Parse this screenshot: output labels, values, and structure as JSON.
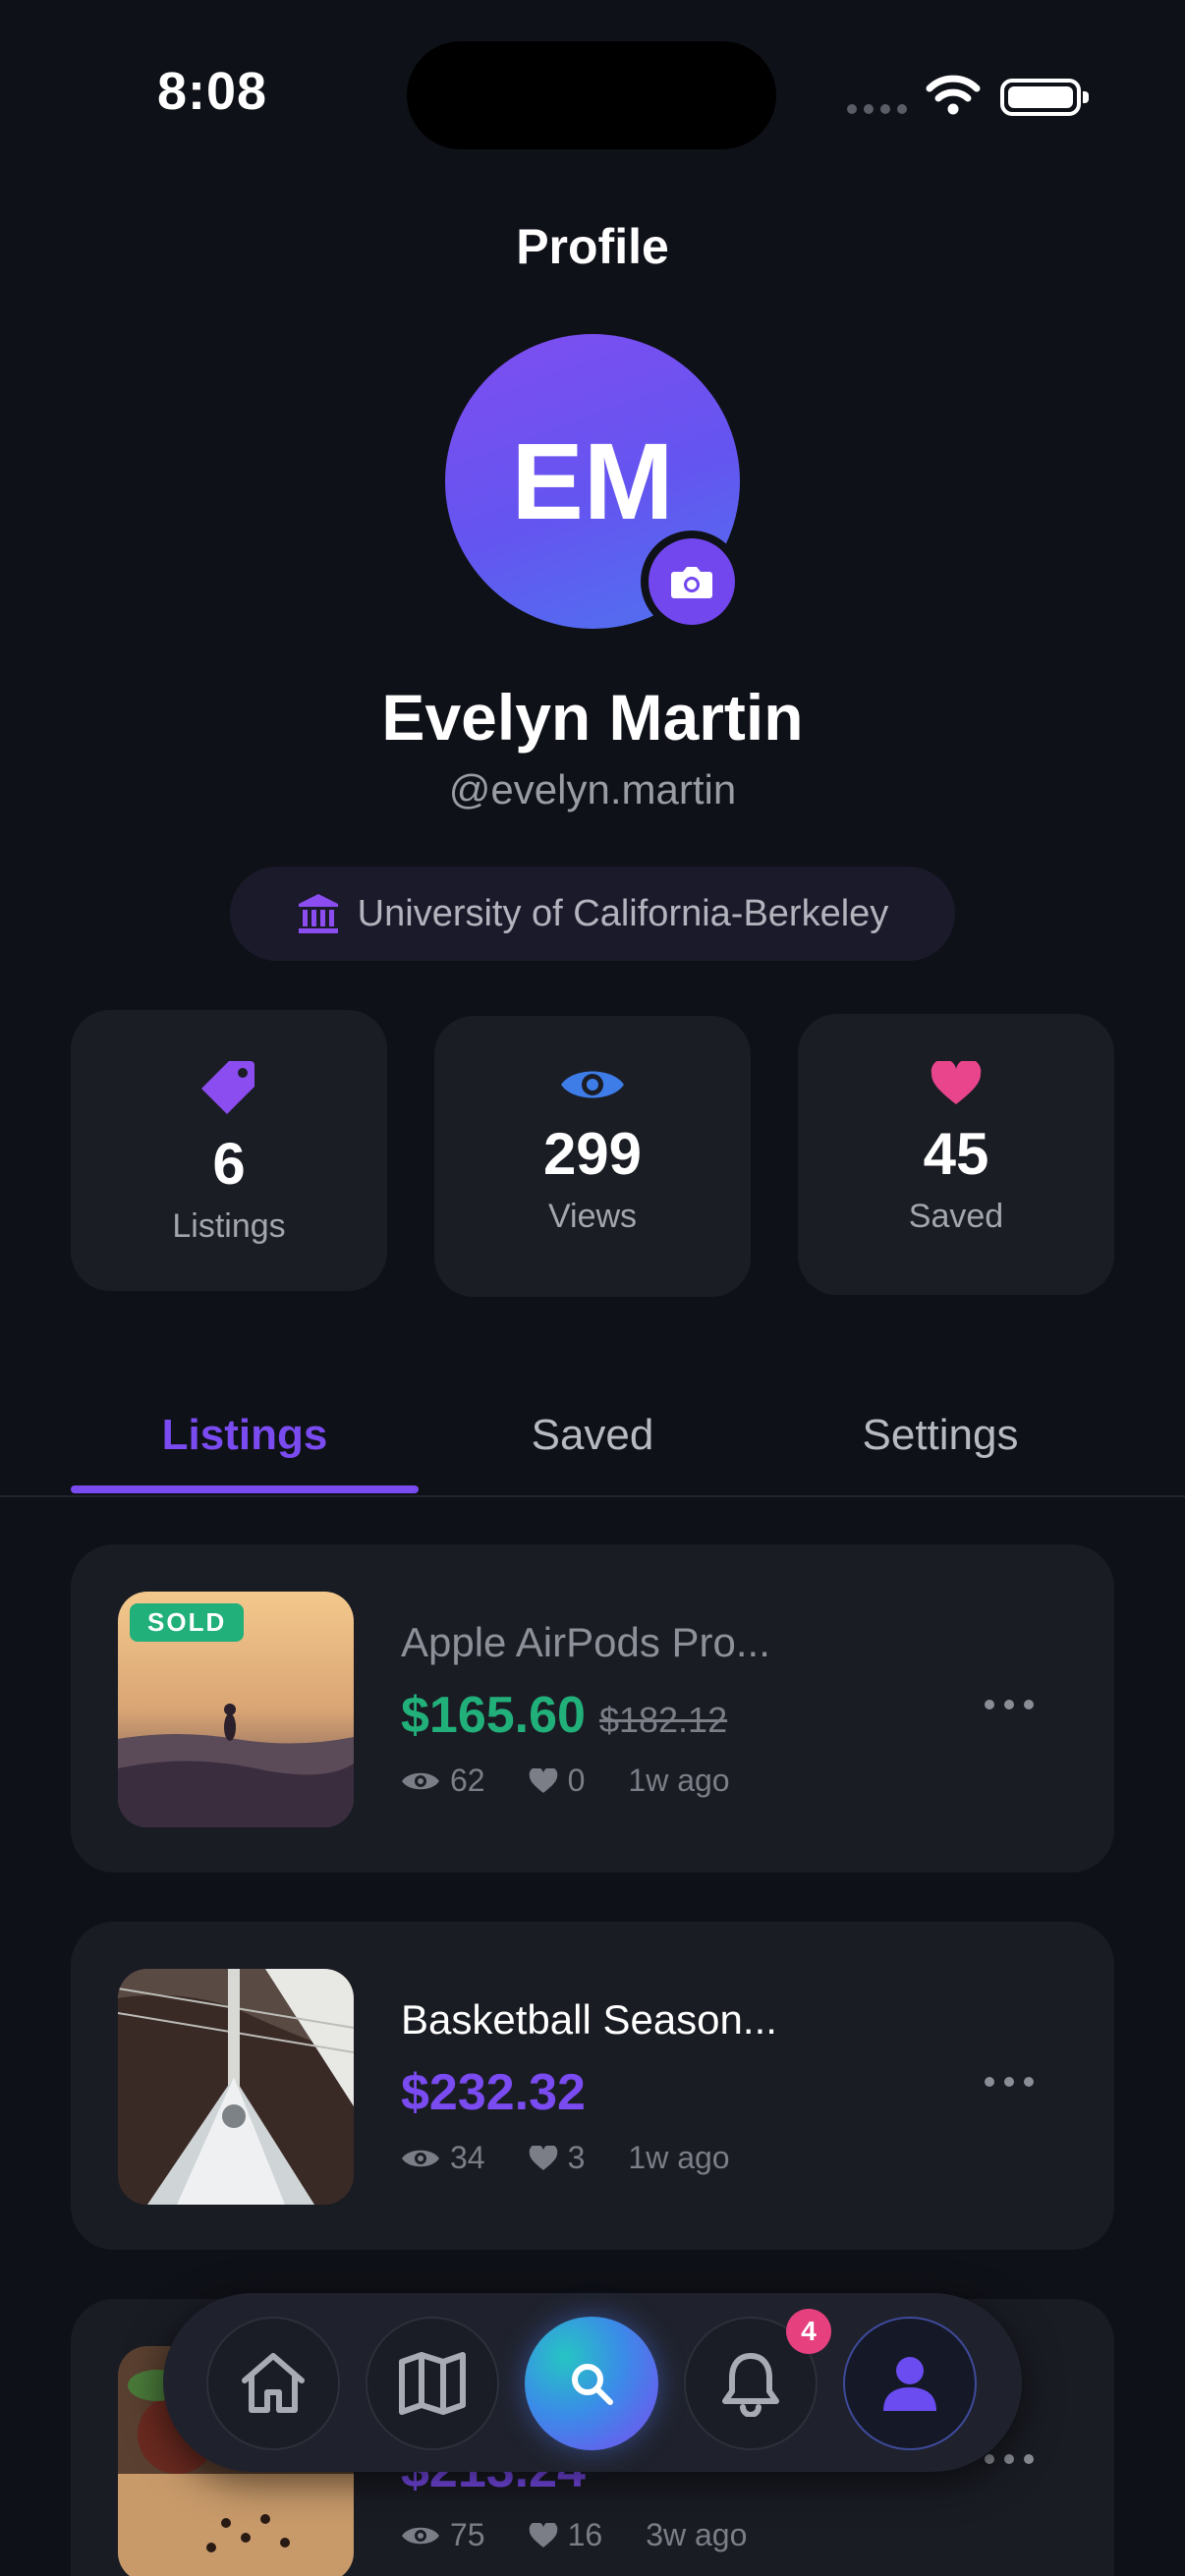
{
  "status_bar": {
    "time": "8:08"
  },
  "header": {
    "title": "Profile"
  },
  "profile": {
    "initials": "EM",
    "name": "Evelyn Martin",
    "handle": "@evelyn.martin",
    "school": "University of California-Berkeley"
  },
  "stats": [
    {
      "value": "6",
      "label": "Listings",
      "icon": "tag-icon",
      "color": "#8b4df0"
    },
    {
      "value": "299",
      "label": "Views",
      "icon": "eye-icon",
      "color": "#3e7de8"
    },
    {
      "value": "45",
      "label": "Saved",
      "icon": "heart-icon",
      "color": "#e8458c"
    }
  ],
  "tabs": [
    {
      "label": "Listings",
      "active": true
    },
    {
      "label": "Saved",
      "active": false
    },
    {
      "label": "Settings",
      "active": false
    }
  ],
  "listings": [
    {
      "title": "Apple AirPods Pro...",
      "price": "$165.60",
      "original_price": "$182.12",
      "views": "62",
      "likes": "0",
      "age": "1w ago",
      "badge": "SOLD",
      "price_color": "#21b07a"
    },
    {
      "title": "Basketball Season...",
      "price": "$232.32",
      "views": "34",
      "likes": "3",
      "age": "1w ago",
      "price_color": "#7a4bf0"
    },
    {
      "title": "",
      "price": "$213.24",
      "views": "75",
      "likes": "16",
      "age": "3w ago",
      "price_color": "#7a4bf0"
    }
  ],
  "nav": {
    "items": [
      "home-icon",
      "map-icon",
      "search-icon",
      "bell-icon",
      "user-icon"
    ],
    "notification_count": "4"
  },
  "colors": {
    "accent": "#7a4bf0",
    "success": "#21b07a",
    "background": "#0f1118"
  }
}
